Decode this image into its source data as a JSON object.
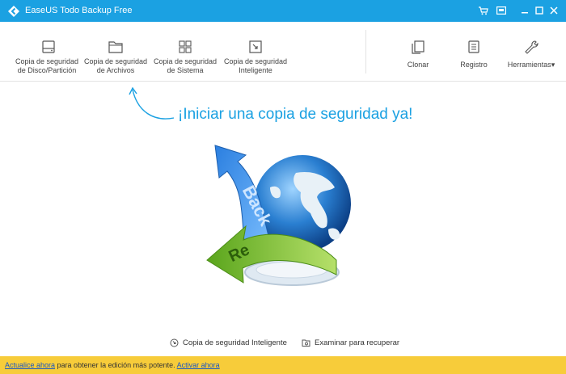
{
  "app": {
    "title": "EaseUS Todo Backup Free"
  },
  "titlebar": {
    "buttons": {
      "cart": "cart-icon",
      "feedback": "screen-icon",
      "minimize": "minimize-icon",
      "maximize": "maximize-icon",
      "close": "close-icon"
    }
  },
  "toolbar": {
    "disk_backup": {
      "line1": "Copia de seguridad",
      "line2": "de Disco/Partición"
    },
    "file_backup": {
      "line1": "Copia de seguridad",
      "line2": "de Archivos"
    },
    "system_backup": {
      "line1": "Copia de seguridad",
      "line2": "de Sistema"
    },
    "smart_backup": {
      "line1": "Copia de seguridad",
      "line2": "Inteligente"
    },
    "clone": "Clonar",
    "log": "Registro",
    "tools": "Herramientas",
    "tools_arrow": "▾"
  },
  "main": {
    "headline": "¡Iniciar una copia de seguridad ya!",
    "illustration_text_1": "Back",
    "illustration_text_2": "Re"
  },
  "bottom_links": {
    "smart_backup": "Copia de seguridad Inteligente",
    "browse_recover": "Examinar para recuperar"
  },
  "statusbar": {
    "update_link": "Actualice ahora",
    "middle_text": " para obtener la edición más potente. ",
    "activate_link": "Activar ahora"
  },
  "colors": {
    "accent": "#1ba1e2",
    "status_bar": "#f7cc3a",
    "link": "#1a56c4"
  }
}
